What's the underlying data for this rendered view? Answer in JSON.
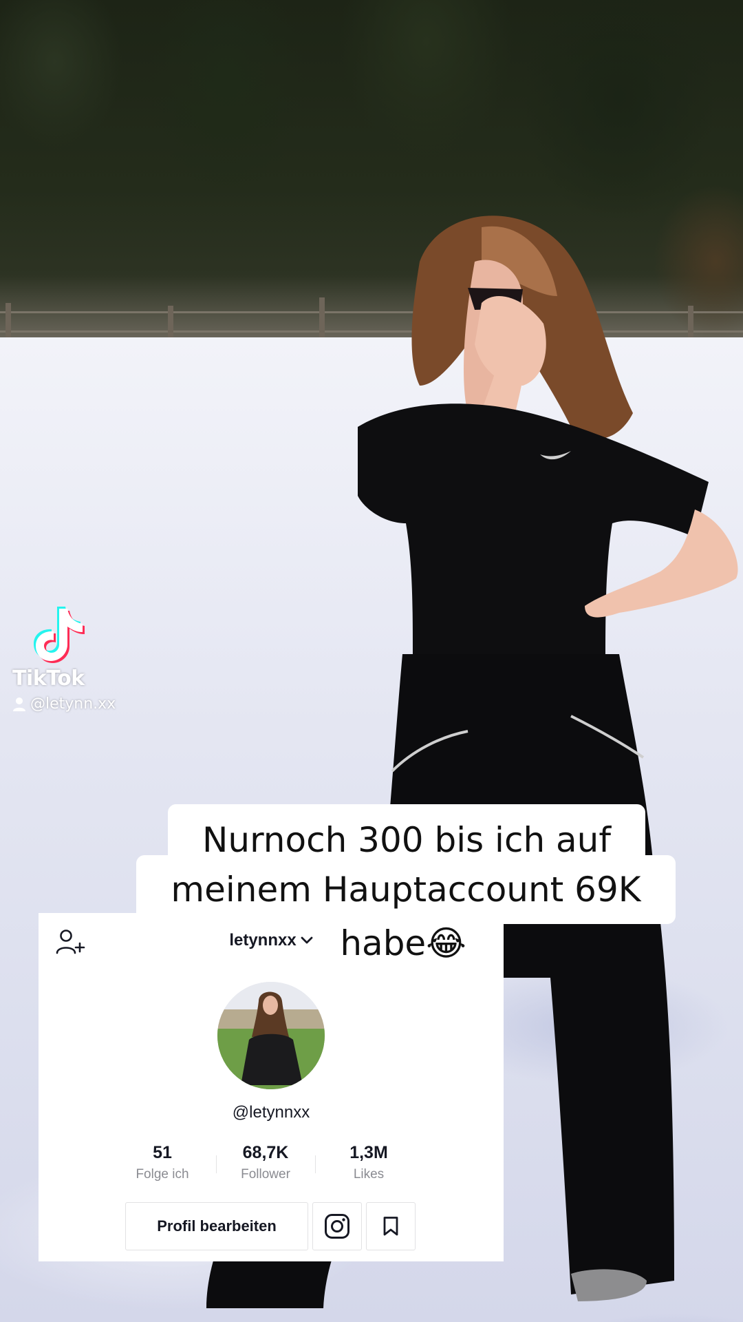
{
  "watermark": {
    "brand": "TikTok",
    "user": "@letynn.xx",
    "logo_icon": "tiktok-note-icon",
    "user_icon": "person-icon"
  },
  "caption": {
    "line1": "Nurnoch 300 bis ich auf",
    "line2": "meinem Hauptaccount 69K",
    "line3": "habe😂"
  },
  "profile": {
    "username": "letynnxx",
    "handle": "@letynnxx",
    "stats": [
      {
        "value": "51",
        "label": "Folge ich"
      },
      {
        "value": "68,7K",
        "label": "Follower"
      },
      {
        "value": "1,3M",
        "label": "Likes"
      }
    ],
    "edit_button": "Profil bearbeiten",
    "icons": {
      "add_user": "add-user-icon",
      "dropdown": "chevron-down-icon",
      "instagram": "instagram-icon",
      "bookmark": "bookmark-icon"
    }
  },
  "colors": {
    "text_primary": "#161823",
    "text_secondary": "#8a8b91",
    "tiktok_cyan": "#25f4ee",
    "tiktok_red": "#fe2c55"
  }
}
